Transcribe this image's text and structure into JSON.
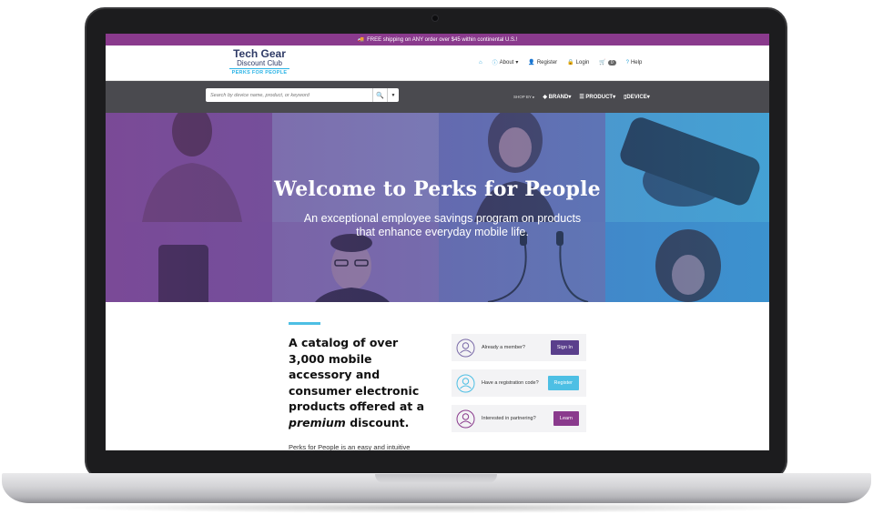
{
  "promo": {
    "icon": "truck-icon",
    "text": "FREE shipping on ANY order over $45 within continental U.S.!"
  },
  "logo": {
    "line1": "Tech Gear",
    "line2": "Discount Club",
    "line3": "PERKS FOR PEOPLE"
  },
  "top_nav": {
    "home_icon": "home-icon",
    "about": "About",
    "register": "Register",
    "login": "Login",
    "cart_count": "0",
    "help": "Help"
  },
  "search": {
    "placeholder": "Search by device name, product, or keyword"
  },
  "category_nav": {
    "shop_by": "SHOP BY",
    "brand": "BRAND",
    "product": "PRODUCT",
    "device": "DEVICE"
  },
  "hero": {
    "title": "Welcome to Perks for People",
    "subtitle": "An exceptional employee savings program on products that enhance everyday mobile life."
  },
  "content": {
    "catalog_before": "A catalog of over 3,000 mobile accessory and consumer electronic products offered at a",
    "catalog_em": "premium",
    "catalog_after": "discount.",
    "intro": "Perks for People is an easy and intuitive"
  },
  "cta_cards": [
    {
      "text": "Already a member?",
      "button": "Sign In",
      "color": "#5a3f8c"
    },
    {
      "text": "Have a registration code?",
      "button": "Register",
      "color": "#4dbfe4"
    },
    {
      "text": "Interested in partnering?",
      "button": "Learn",
      "color": "#8a3a8d"
    }
  ],
  "colors": {
    "brand_purple": "#8a3a8d",
    "brand_blue": "#4dbfe4",
    "nav_dark": "#4a4a4f"
  }
}
